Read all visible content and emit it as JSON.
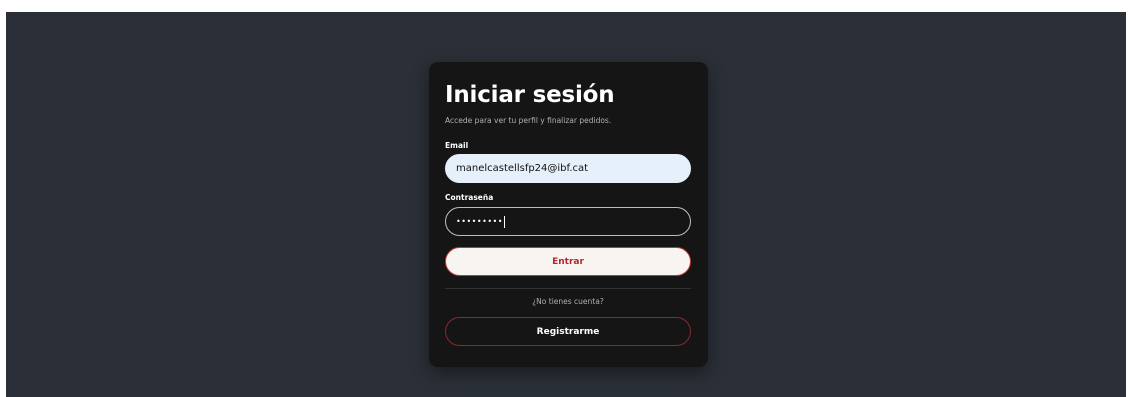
{
  "login": {
    "title": "Iniciar sesión",
    "subtitle": "Accede para ver tu perfil y finalizar pedidos.",
    "email_label": "Email",
    "email_value": "manelcastellsfp24@ibf.cat",
    "password_label": "Contraseña",
    "password_mask": "•••••••••",
    "submit_label": "Entrar",
    "no_account_prompt": "¿No tienes cuenta?",
    "register_label": "Registrarme"
  },
  "colors": {
    "page_background": "#2b3038",
    "card_background": "#151515",
    "email_field_background": "#e6f0fb",
    "primary_button_text": "#b3262b",
    "secondary_button_border": "#8a2a2a"
  }
}
